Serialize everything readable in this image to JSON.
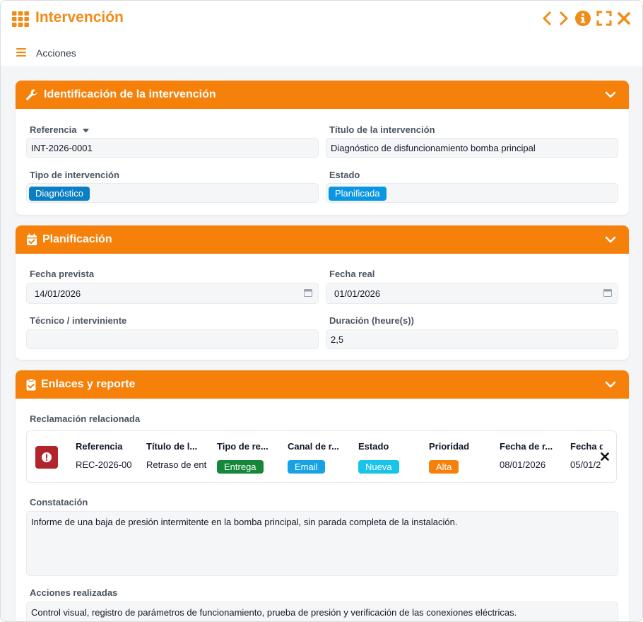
{
  "window": {
    "title": "Intervención",
    "actions_label": "Acciones",
    "accent_color": "#f5800a",
    "title_color": "#f08b18"
  },
  "toolbar_icons": [
    "grid-icon",
    "chevron-left-icon",
    "chevron-right-icon",
    "info-icon",
    "fullscreen-icon",
    "close-icon"
  ],
  "identificacion": {
    "title": "Identificación de la intervención",
    "referencia_label": "Referencia",
    "referencia_value": "INT-2026-0001",
    "titulo_label": "Título de la intervención",
    "titulo_value": "Diagnóstico de disfuncionamiento bomba principal",
    "tipo_label": "Tipo de intervención",
    "tipo_value": "Diagnóstico",
    "tipo_color": "#0b7fc4",
    "estado_label": "Estado",
    "estado_value": "Planificada",
    "estado_color": "#0a96e0"
  },
  "planificacion": {
    "title": "Planificación",
    "fecha_prevista_label": "Fecha prevista",
    "fecha_prevista_value": "14/01/2026",
    "fecha_real_label": "Fecha real",
    "fecha_real_value": "01/01/2026",
    "tecnico_label": "Técnico / interviniente",
    "tecnico_value": "",
    "duracion_label": "Duración (heure(s))",
    "duracion_value": "2,5"
  },
  "enlaces": {
    "title": "Enlaces y reporte",
    "reclamacion_label": "Reclamación relacionada",
    "columns": [
      "Referencia",
      "Título de l...",
      "Tipo de re...",
      "Canal de r...",
      "Estado",
      "Prioridad",
      "Fecha de r...",
      "Fecha d"
    ],
    "row": {
      "referencia": "REC-2026-00",
      "titulo": "Retraso de ent",
      "tipo": "Entrega",
      "tipo_color": "#16873a",
      "canal": "Email",
      "canal_color": "#18a2e4",
      "estado": "Nueva",
      "estado_color": "#19c3ea",
      "prioridad": "Alta",
      "prioridad_color": "#f5800a",
      "fecha1": "08/01/2026",
      "fecha2": "05/01/2"
    },
    "constatacion_label": "Constatación",
    "constatacion_value": "Informe de una baja de presión intermitente en la bomba principal, sin parada completa de la instalación.",
    "acciones_label": "Acciones realizadas",
    "acciones_value": "Control visual, registro de parámetros de funcionamiento, prueba de presión y verificación de las conexiones eléctricas."
  }
}
